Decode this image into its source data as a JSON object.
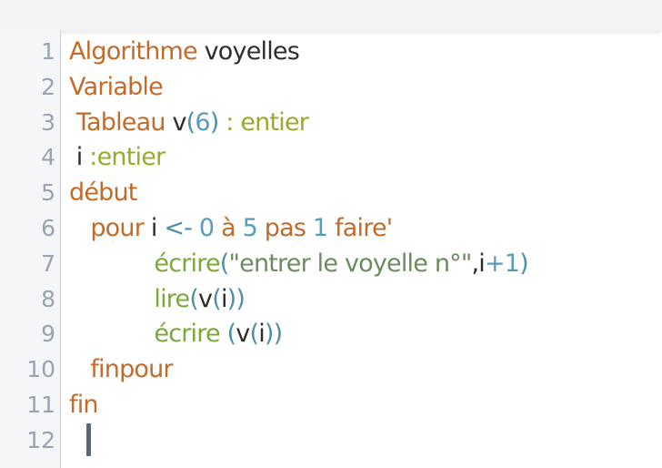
{
  "colors": {
    "keyword": "#c26b2a",
    "function": "#7ba83a",
    "type": "#9aaa2c",
    "paren": "#4f8fa6",
    "number": "#5a9cb8",
    "string": "#6b8c5e",
    "plain": "#2d2d2d",
    "gutter_text": "#9aa3b2",
    "caret": "#5b6577"
  },
  "editor": {
    "line_numbers": [
      "1",
      "2",
      "3",
      "4",
      "5",
      "6",
      "7",
      "8",
      "9",
      "10",
      "11",
      "12"
    ],
    "lines": [
      [
        {
          "t": "Algorithme",
          "c": "keyword"
        },
        {
          "t": " voyelles",
          "c": "plain"
        }
      ],
      [
        {
          "t": "Variable",
          "c": "keyword"
        }
      ],
      [
        {
          "t": " Tableau",
          "c": "keyword"
        },
        {
          "t": " v",
          "c": "plain"
        },
        {
          "t": "(",
          "c": "paren"
        },
        {
          "t": "6",
          "c": "number"
        },
        {
          "t": ")",
          "c": "paren"
        },
        {
          "t": " : entier",
          "c": "type"
        }
      ],
      [
        {
          "t": " i ",
          "c": "plain"
        },
        {
          "t": ":entier",
          "c": "type"
        }
      ],
      [
        {
          "t": "début",
          "c": "keyword"
        }
      ],
      [
        {
          "t": "   pour",
          "c": "keyword"
        },
        {
          "t": " i ",
          "c": "plain"
        },
        {
          "t": "<-",
          "c": "paren"
        },
        {
          "t": " ",
          "c": "plain"
        },
        {
          "t": "0",
          "c": "number"
        },
        {
          "t": " à ",
          "c": "keyword"
        },
        {
          "t": "5",
          "c": "number"
        },
        {
          "t": " pas ",
          "c": "keyword"
        },
        {
          "t": "1",
          "c": "number"
        },
        {
          "t": " faire'",
          "c": "keyword"
        }
      ],
      [
        {
          "t": "            écrire",
          "c": "function"
        },
        {
          "t": "(",
          "c": "paren"
        },
        {
          "t": "\"entrer le voyelle n°\"",
          "c": "string"
        },
        {
          "t": ",i",
          "c": "plain"
        },
        {
          "t": "+1",
          "c": "number"
        },
        {
          "t": ")",
          "c": "paren"
        }
      ],
      [
        {
          "t": "            lire",
          "c": "function"
        },
        {
          "t": "(",
          "c": "paren"
        },
        {
          "t": "v",
          "c": "plain"
        },
        {
          "t": "(",
          "c": "paren"
        },
        {
          "t": "i",
          "c": "plain"
        },
        {
          "t": "))",
          "c": "paren"
        }
      ],
      [
        {
          "t": "            écrire ",
          "c": "function"
        },
        {
          "t": "(",
          "c": "paren"
        },
        {
          "t": "v",
          "c": "plain"
        },
        {
          "t": "(",
          "c": "paren"
        },
        {
          "t": "i",
          "c": "plain"
        },
        {
          "t": "))",
          "c": "paren"
        }
      ],
      [
        {
          "t": "   finpour",
          "c": "keyword"
        }
      ],
      [
        {
          "t": "fin",
          "c": "keyword"
        }
      ],
      []
    ]
  }
}
